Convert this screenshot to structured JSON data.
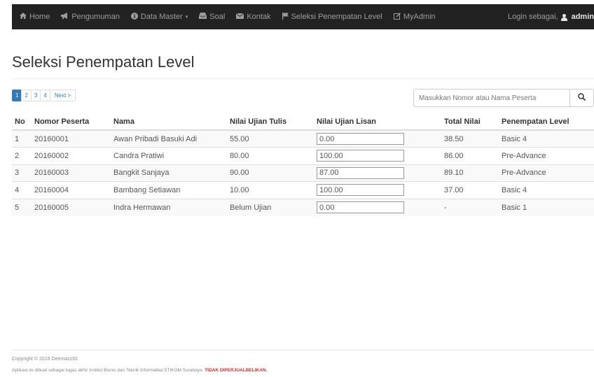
{
  "navbar": {
    "items": [
      {
        "label": "Home",
        "icon": "home-icon"
      },
      {
        "label": "Pengumuman",
        "icon": "bullhorn-icon"
      },
      {
        "label": "Data Master",
        "icon": "info-icon",
        "dropdown": true
      },
      {
        "label": "Soal",
        "icon": "inbox-icon"
      },
      {
        "label": "Kontak",
        "icon": "envelope-icon"
      },
      {
        "label": "Seleksi Penempatan Level",
        "icon": "flag-icon"
      },
      {
        "label": "MyAdmin",
        "icon": "edit-icon"
      }
    ],
    "login_text": "Login sebagai,",
    "user": "admin"
  },
  "page": {
    "title": "Seleksi Penempatan Level"
  },
  "pagination": {
    "pages": [
      "1",
      "2",
      "3",
      "4"
    ],
    "active": "1",
    "next": "Next >"
  },
  "search": {
    "placeholder": "Masukkan Nomor atau Nama Peserta",
    "value": ""
  },
  "table": {
    "headers": [
      "No",
      "Nomor Peserta",
      "Nama",
      "Nilai Ujian Tulis",
      "Nilai Ujian Lisan",
      "Total Nilai",
      "Penempatan Level"
    ],
    "rows": [
      {
        "no": "1",
        "nomor": "20160001",
        "nama": "Awan Pribadi Basuki Adi",
        "tulis": "55.00",
        "lisan": "0.00",
        "total": "38.50",
        "level": "Basic 4"
      },
      {
        "no": "2",
        "nomor": "20160002",
        "nama": "Candra Pratiwi",
        "tulis": "80.00",
        "lisan": "100.00",
        "total": "86.00",
        "level": "Pre-Advance"
      },
      {
        "no": "3",
        "nomor": "20160003",
        "nama": "Bangkit Sanjaya",
        "tulis": "90.00",
        "lisan": "87.00",
        "total": "89.10",
        "level": "Pre-Advance"
      },
      {
        "no": "4",
        "nomor": "20160004",
        "nama": "Bambang Setiawan",
        "tulis": "10.00",
        "lisan": "100.00",
        "total": "37.00",
        "level": "Basic 4"
      },
      {
        "no": "5",
        "nomor": "20160005",
        "nama": "Indra Hermawan",
        "tulis": "Belum Ujian",
        "lisan": "0.00",
        "total": "-",
        "level": "Basic 1"
      }
    ]
  },
  "footer": {
    "copyright": "Copyright © 2016 Deemazz92.",
    "note": "Aplikasi ini dibuat sebagai tugas akhir Institut Bisnis dan Teknik Informatika STIKOM Surabaya.",
    "warning": "TIDAK DIPERJUALBELIKAN."
  },
  "colors": {
    "navbar": "#222222",
    "primary": "#337ab7",
    "danger": "#d9231f"
  }
}
